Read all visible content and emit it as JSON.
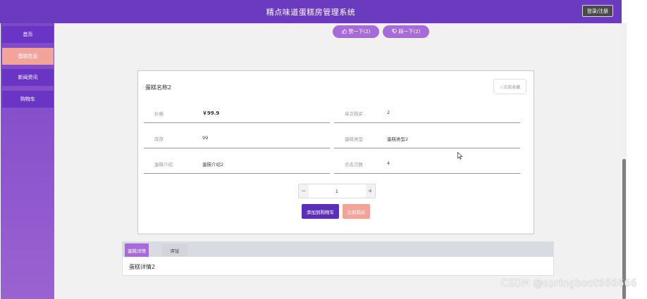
{
  "header": {
    "title": "精点味道蛋糕房管理系统",
    "login_label": "登录/注册"
  },
  "sidebar": {
    "items": [
      {
        "label": "首页"
      },
      {
        "label": "蛋糕信息"
      },
      {
        "label": "新闻资讯"
      },
      {
        "label": "购物车"
      }
    ],
    "active_index": 1
  },
  "actions": {
    "like_label": "赞一下(2)",
    "dislike_label": "踩一下(2)"
  },
  "product": {
    "name": "蛋糕名称2",
    "favorite_label": "☆点我收藏",
    "fields": [
      {
        "label": "价格",
        "value": "￥99.9"
      },
      {
        "label": "单次购买",
        "value": "2"
      },
      {
        "label": "库存",
        "value": "99"
      },
      {
        "label": "蛋糕类型",
        "value": "蛋糕类型2"
      },
      {
        "label": "蛋糕介绍",
        "value": "蛋糕介绍2"
      },
      {
        "label": "点击次数",
        "value": "4"
      }
    ],
    "quantity": "1",
    "minus_glyph": "−",
    "plus_glyph": "+",
    "add_to_cart_label": "添加到购物车",
    "buy_now_label": "立即购买"
  },
  "tabs": {
    "items": [
      {
        "label": "蛋糕详情"
      },
      {
        "label": "评论"
      }
    ],
    "active_index": 0,
    "content": "蛋糕详情2"
  },
  "watermark": "CSDN @springboot666666",
  "colors": {
    "header_bg": "#6a3bbf",
    "sidebar_item": "#6a35c4",
    "sidebar_active": "#f2a49a",
    "accent_purple": "#a66bd9",
    "add_to_cart": "#5b2fb8",
    "buy_now": "#f2a49a"
  },
  "icons": {
    "like": "thumbs-up-icon",
    "dislike": "thumbs-down-icon",
    "favorite": "star-outline-icon",
    "cursor": "mouse-pointer-icon"
  }
}
